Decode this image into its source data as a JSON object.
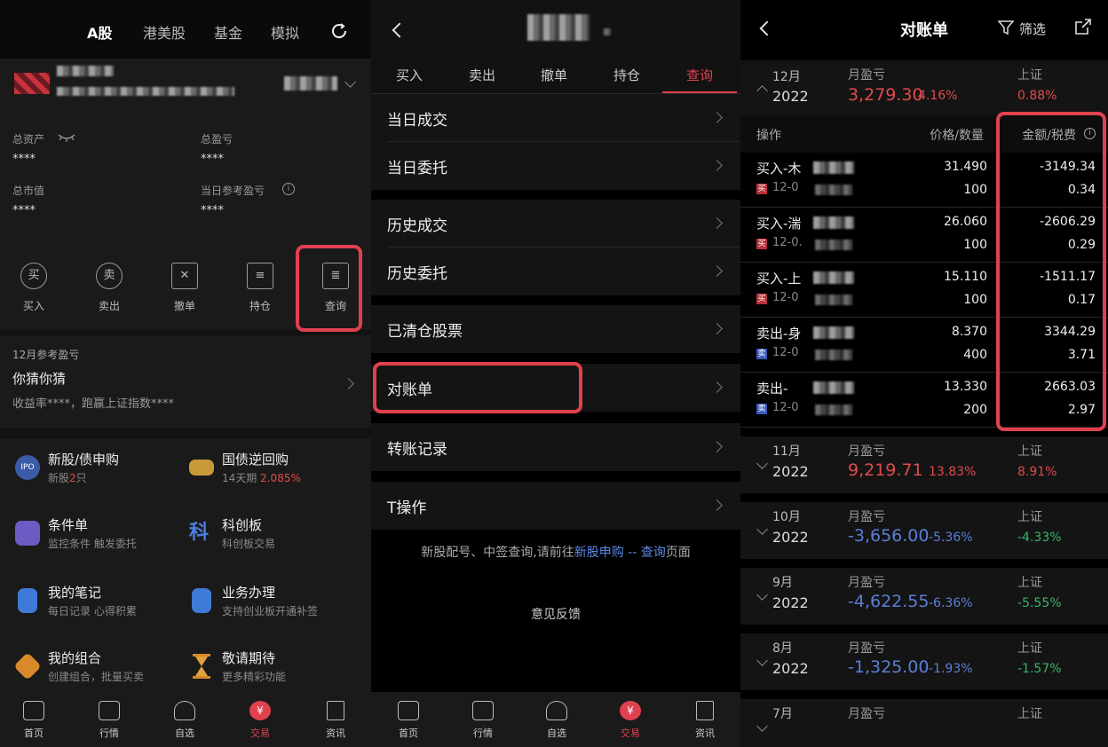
{
  "left": {
    "tabs": [
      "A股",
      "港美股",
      "基金",
      "模拟"
    ],
    "refresh_icon": "refresh-icon",
    "stats": [
      {
        "label": "总资产",
        "value": "****"
      },
      {
        "label": "总盈亏",
        "value": "****"
      },
      {
        "label": "总市值",
        "value": "****"
      },
      {
        "label": "当日参考盈亏",
        "value": "****"
      }
    ],
    "tools": [
      {
        "icon": "买",
        "label": "买入"
      },
      {
        "icon": "卖",
        "label": "卖出"
      },
      {
        "icon": "✕",
        "label": "撤单"
      },
      {
        "icon": "≡",
        "label": "持仓"
      },
      {
        "icon": "≣",
        "label": "查询"
      }
    ],
    "monthly": {
      "title": "12月参考盈亏",
      "guess": "你猜你猜",
      "sub": "收益率****，跑赢上证指数****"
    },
    "services": [
      {
        "title": "新股/债申购",
        "sub_pre": "新股",
        "sub_num": "2",
        "sub_post": "只",
        "icon": "IPO"
      },
      {
        "title": "国债逆回购",
        "sub_pre": "14天期",
        "sub_num": "2.085%",
        "sub_post": "",
        "icon": "ticket"
      },
      {
        "title": "条件单",
        "sub_pre": "监控条件 触发委托",
        "sub_num": "",
        "sub_post": "",
        "icon": "bulb"
      },
      {
        "title": "科创板",
        "sub_pre": "科创板交易",
        "sub_num": "",
        "sub_post": "",
        "icon": "科"
      },
      {
        "title": "我的笔记",
        "sub_pre": "每日记录 心得积累",
        "sub_num": "",
        "sub_post": "",
        "icon": "note"
      },
      {
        "title": "业务办理",
        "sub_pre": "支持创业板开通补签",
        "sub_num": "",
        "sub_post": "",
        "icon": "list"
      },
      {
        "title": "我的组合",
        "sub_pre": "创建组合，批量买卖",
        "sub_num": "",
        "sub_post": "",
        "icon": "box"
      },
      {
        "title": "敬请期待",
        "sub_pre": "更多精彩功能",
        "sub_num": "",
        "sub_post": "",
        "icon": "hourglass"
      }
    ]
  },
  "nav": [
    {
      "label": "首页",
      "icon": "candlestick-icon"
    },
    {
      "label": "行情",
      "icon": "chart-icon"
    },
    {
      "label": "自选",
      "icon": "user-icon"
    },
    {
      "label": "交易",
      "icon": "yen-icon"
    },
    {
      "label": "资讯",
      "icon": "doc-icon"
    }
  ],
  "nav_yen": "¥",
  "mid": {
    "tabs": [
      "买入",
      "卖出",
      "撤单",
      "持仓",
      "查询"
    ],
    "rows": [
      "当日成交",
      "当日委托",
      "历史成交",
      "历史委托",
      "已清仓股票",
      "对账单",
      "转账记录",
      "T操作"
    ],
    "note": {
      "pre": "新股配号、中签查询,请前往",
      "link1": "新股申购",
      "sep": " -- ",
      "link2": "查询",
      "post": "页面"
    },
    "feedback": "意见反馈"
  },
  "right": {
    "title": "对账单",
    "filter": "筛选",
    "dec": {
      "month": "12月",
      "year": "2022",
      "pl_label": "月盈亏",
      "pl": "3,279.30",
      "pct": "4.16%",
      "sh_label": "上证",
      "sh": "0.88%"
    },
    "head": {
      "op": "操作",
      "pq": "价格/数量",
      "af": "金额/税费"
    },
    "trades": [
      {
        "op": "买入-木",
        "badge": "买",
        "date": "12-0",
        "price": "31.490",
        "qty": "100",
        "amt": "-3149.34",
        "fee": "0.34"
      },
      {
        "op": "买入-湍",
        "badge": "买",
        "date": "12-0.",
        "price": "26.060",
        "qty": "100",
        "amt": "-2606.29",
        "fee": "0.29"
      },
      {
        "op": "买入-上",
        "badge": "买",
        "date": "12-0",
        "price": "15.110",
        "qty": "100",
        "amt": "-1511.17",
        "fee": "0.17"
      },
      {
        "op": "卖出-身",
        "badge": "卖",
        "date": "12-0",
        "price": "8.370",
        "qty": "400",
        "amt": "3344.29",
        "fee": "3.71"
      },
      {
        "op": "卖出-",
        "badge": "卖",
        "date": "12-0",
        "price": "13.330",
        "qty": "200",
        "amt": "2663.03",
        "fee": "2.97"
      }
    ],
    "months": [
      {
        "month": "11月",
        "year": "2022",
        "pl_label": "月盈亏",
        "pl": "9,219.71",
        "pct": "13.83%",
        "sh_label": "上证",
        "sh": "8.91%",
        "pl_color": "up",
        "sh_color": "up"
      },
      {
        "month": "10月",
        "year": "2022",
        "pl_label": "月盈亏",
        "pl": "-3,656.00",
        "pct": "-5.36%",
        "sh_label": "上证",
        "sh": "-4.33%",
        "pl_color": "dn",
        "sh_color": "gr"
      },
      {
        "month": "9月",
        "year": "2022",
        "pl_label": "月盈亏",
        "pl": "-4,622.55",
        "pct": "-6.36%",
        "sh_label": "上证",
        "sh": "-5.55%",
        "pl_color": "dn",
        "sh_color": "gr"
      },
      {
        "month": "8月",
        "year": "2022",
        "pl_label": "月盈亏",
        "pl": "-1,325.00",
        "pct": "-1.93%",
        "sh_label": "上证",
        "sh": "-1.57%",
        "pl_color": "dn",
        "sh_color": "gr"
      },
      {
        "month": "7月",
        "year": "",
        "pl_label": "月盈亏",
        "pl": "",
        "pct": "",
        "sh_label": "上证",
        "sh": "",
        "pl_color": "dn",
        "sh_color": "gr"
      }
    ]
  },
  "colors": {
    "accent": "#e0414f",
    "up": "#e34a4a",
    "down": "#5b7fd6",
    "green": "#39b56a"
  }
}
